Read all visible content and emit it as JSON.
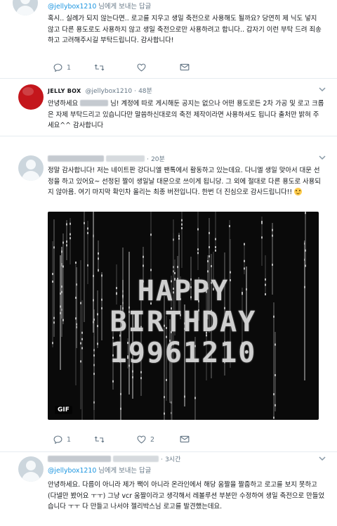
{
  "tweets": [
    {
      "reply_handle": "@jellybox1210",
      "reply_suffix": " 님에게 보내는 답글",
      "text": "혹시.. 실례가 되지 않는다면.. 로고를 지우고 생일 축전으로 사용해도 될까요? 당연히 제 닉도 넣지 않고 다른 용도로도 사용하지 않고 생일 축전으로만 사용하려고 합니다.. 갑자기 이런 부탁 드려 죄송하고 고려해주시길 부탁드립니다. 감사합니다!",
      "reply_count": "1",
      "retweet_count": "",
      "like_count": ""
    },
    {
      "name": "JELLY BOX",
      "handle": "@jellybox1210",
      "time": "48분",
      "text_part1": "안녕하세요 ",
      "text_part2": " 님! 계정에 따로 게시해둔 공지는 없으나 어떤 용도로든 2차 가공 및 로고 크롭은 자제 부탁드리고 있습니다만 말씀하신대로의 축전 제작이라면 사용하셔도 됩니다 출처만 밝혀 주세요^^ 감사합니다"
    },
    {
      "time": "20분",
      "text": "정말 감사합니다! 저는 네이트판 강다니엘 팬톡에서 활동하고 있는데요. 다니엘 생일 맞아서 대문 선정을 하고 있어요~ 선정된 짤이 생일날 대문으로 쓰이게 됩니당. 그 외에 절대로 다른 용도로 사용되지 않아욤. 여기 마지막 확인차 올리는 최종 버전입니다. 한번 더 진심으로 감사드립니다!! ",
      "media": {
        "line1": "HAPPY",
        "line2": "BIRTHDAY",
        "line3": "19961210",
        "badge": "GIF"
      },
      "reply_count": "1",
      "retweet_count": "",
      "like_count": "2"
    },
    {
      "time": "3시간",
      "reply_handle": "@jellybox1210",
      "reply_suffix": " 님에게 보내는 답글",
      "text": "안녕하세요. 다름이 아니라 제가 짹이 아니라 온라인에서 해당 움짤을 짤줍하고 로고를 보지 못하고 (다넬만 봤어요 ㅜㅜ) 그냥 vcr 움짤이라고 생각해서 레볼루션 부분만 수정하여 생일 축전으로 만들었습니다 ㅜㅜ 다 만들고 나서야 젤리박스님 로고를 발견했는데요."
    }
  ],
  "colors": {
    "link": "#1b95e0",
    "muted": "#657786",
    "border": "#e6ecf0"
  },
  "icons": [
    "reply-icon",
    "retweet-icon",
    "like-icon",
    "dm-icon",
    "caret-down-icon",
    "smile-emoji"
  ]
}
